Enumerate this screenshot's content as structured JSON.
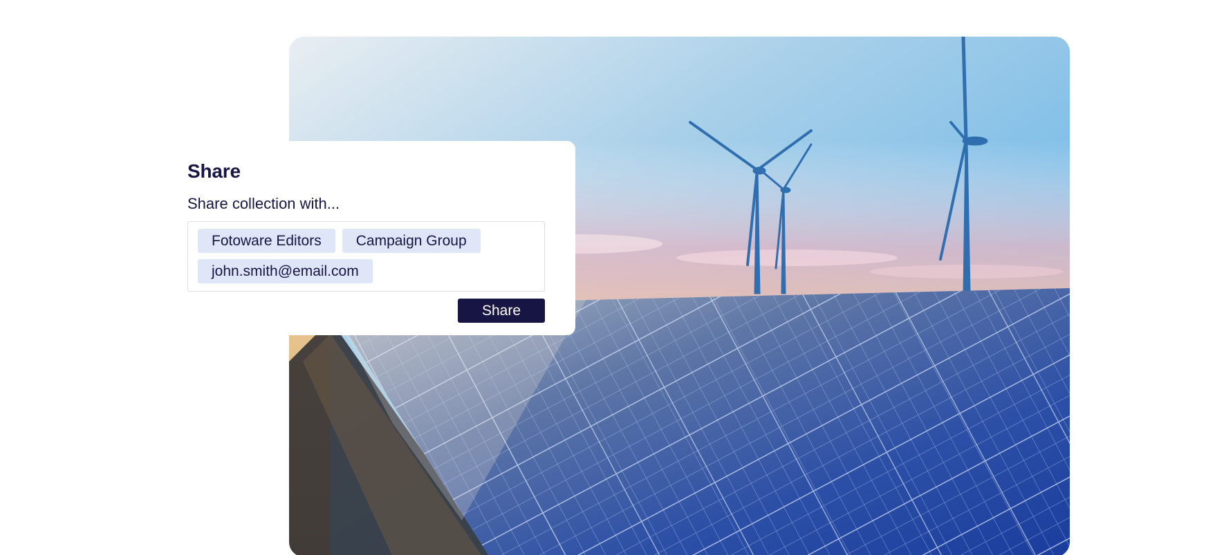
{
  "dialog": {
    "title": "Share",
    "subtitle": "Share collection with...",
    "recipients": [
      {
        "label": "Fotoware Editors"
      },
      {
        "label": "Campaign Group"
      },
      {
        "label": "john.smith@email.com"
      }
    ],
    "share_button_label": "Share"
  },
  "colors": {
    "brand_navy": "#171544",
    "chip_background": "#dfe6f8",
    "input_border": "#dcdde3"
  },
  "hero_image": {
    "subject": "wind-turbines-and-solar-panels-photo"
  }
}
